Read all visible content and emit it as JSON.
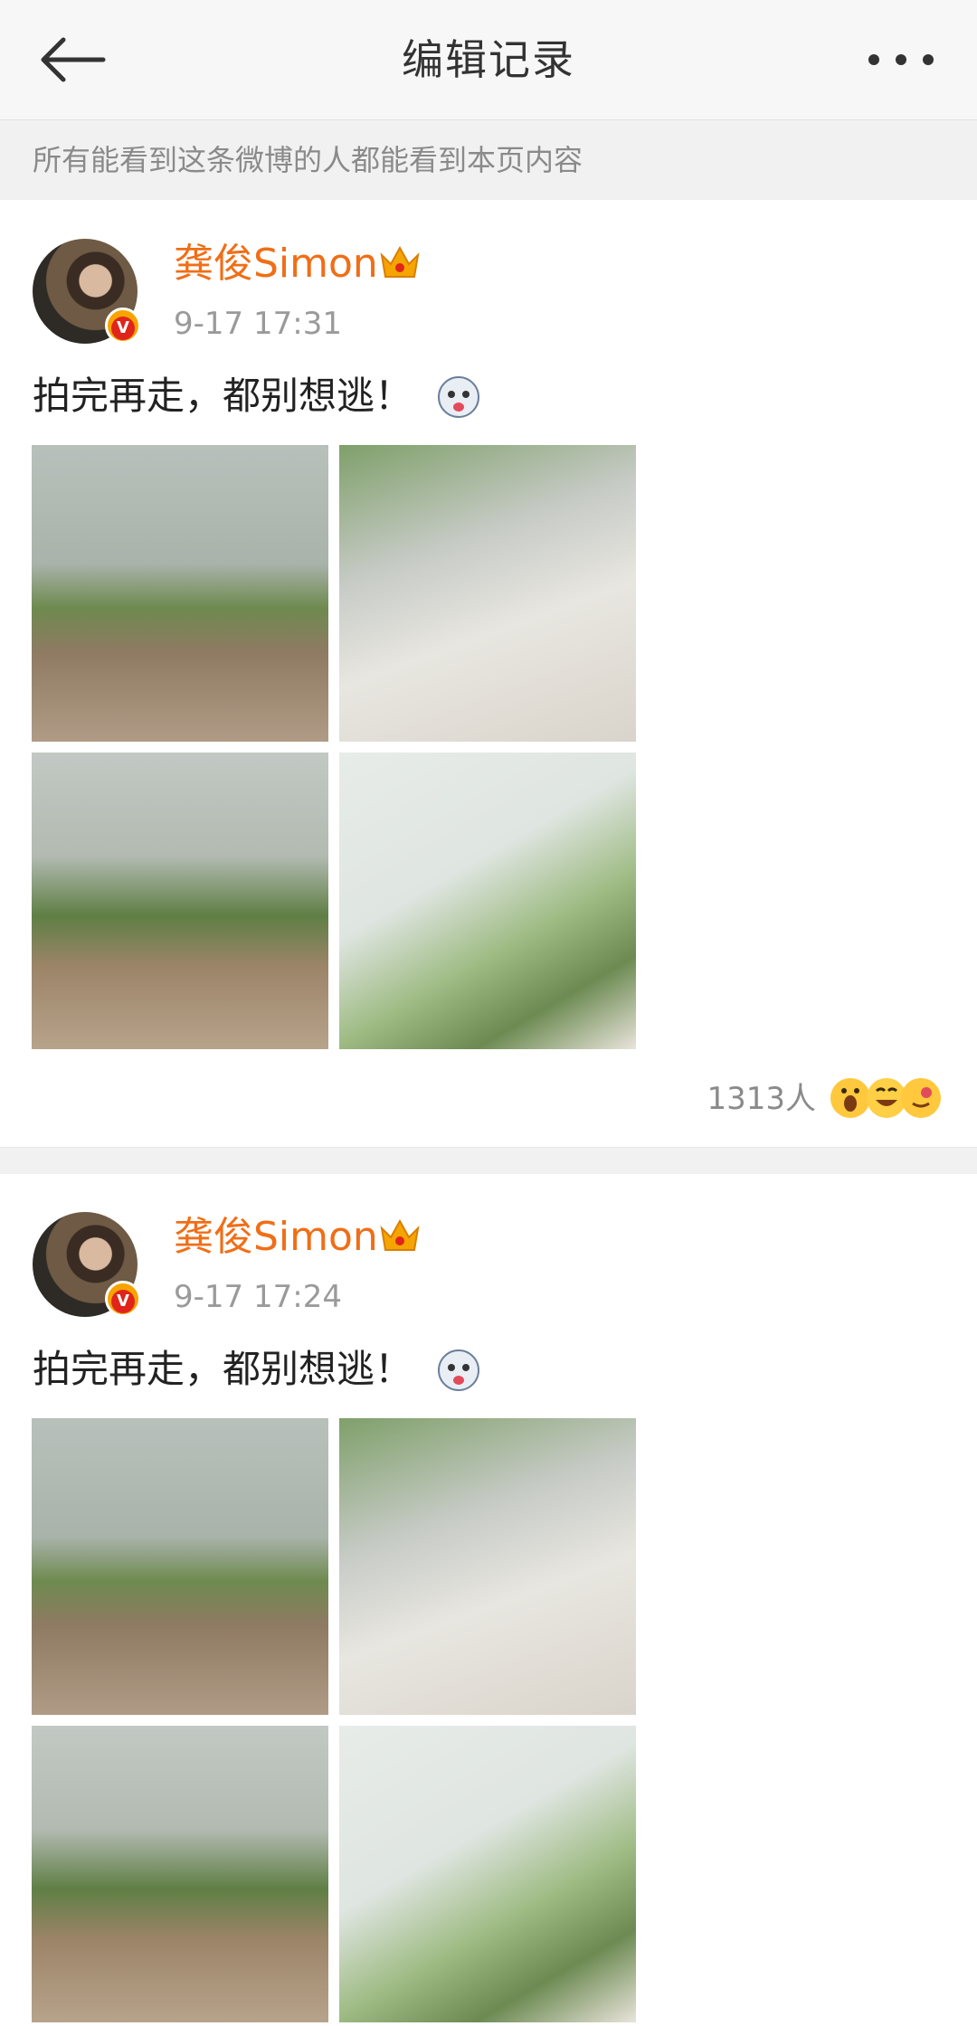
{
  "header": {
    "title": "编辑记录"
  },
  "notice": "所有能看到这条微博的人都能看到本页内容",
  "posts": [
    {
      "username": "龚俊Simon",
      "time": "9-17 17:31",
      "content": "拍完再走，都别想逃！",
      "reactions": "1313人"
    },
    {
      "username": "龚俊Simon",
      "time": "9-17 17:24",
      "content": "拍完再走，都别想逃！"
    }
  ],
  "colors": {
    "username": "#f06e17",
    "accent_badge": "#f6a400"
  },
  "icons": [
    "back-arrow-icon",
    "more-dots-icon",
    "verified-v-icon",
    "crown-icon",
    "husky-emoji-icon",
    "reaction-emoji-icon"
  ]
}
